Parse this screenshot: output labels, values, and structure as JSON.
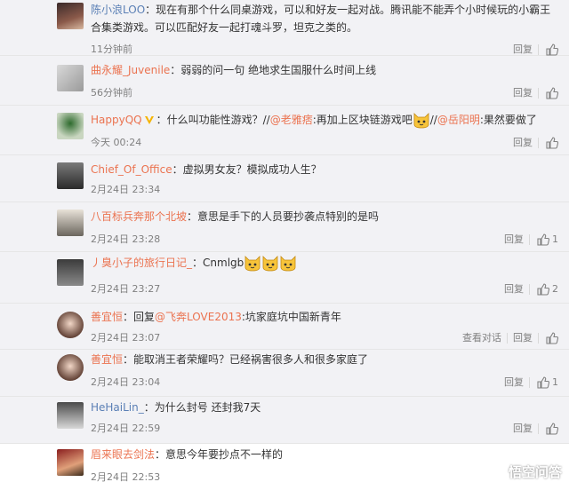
{
  "actions": {
    "reply": "回复",
    "view_dialog": "查看对话"
  },
  "comments": [
    {
      "user": "陈小浪LOO",
      "text": "：现在有那个什么同桌游戏，可以和好友一起对战。腾讯能不能弄个小时候玩的小霸王合集类游戏。可以匹配好友一起打魂斗罗，坦克之类的。",
      "time": "11分钟前"
    },
    {
      "user": "曲永耀_Juvenile",
      "text": "：弱弱的问一句 绝地求生国服什么时间上线",
      "time": "56分钟前"
    },
    {
      "user": "HappyQQ",
      "text_a": "：什么叫功能性游戏？//",
      "mention_a": "@老雅痞",
      "text_b": ":再加上区块链游戏吧",
      "text_c": "//",
      "mention_b": "@岳阳明",
      "text_d": ":果然要做了",
      "time": "今天 00:24"
    },
    {
      "user": "Chief_Of_Office",
      "text": "：虚拟男女友？模拟成功人生？",
      "time": "2月24日 23:34"
    },
    {
      "user": "八百标兵奔那个北坡",
      "text": "：意思是手下的人员要抄袭点特别的是吗",
      "time": "2月24日 23:28",
      "likes": "1"
    },
    {
      "user": "丿臭小子的旅行日记_",
      "text": "：Cnmlgb",
      "time": "2月24日 23:27",
      "likes": "2"
    },
    {
      "user": "善宜恒",
      "text_a": "：回复",
      "mention": "@飞奔LOVE2013",
      "text_b": ":坑家庭坑中国新青年",
      "time": "2月24日 23:07"
    },
    {
      "user": "善宜恒",
      "text": "：能取消王者荣耀吗？已经祸害很多人和很多家庭了",
      "time": "2月24日 23:04",
      "likes": "1"
    },
    {
      "user": "HeHaiLin_",
      "text": "：为什么封号 还封我7天",
      "time": "2月24日 22:59"
    },
    {
      "user": "眉来眼去剑法",
      "text": "：意思今年要抄点不一样的",
      "time": "2月24日 22:53"
    }
  ],
  "watermark": {
    "label": "悟空问答"
  },
  "colors": {
    "username": "#eb7350",
    "mention": "#eb7350",
    "meta": "#808080"
  }
}
